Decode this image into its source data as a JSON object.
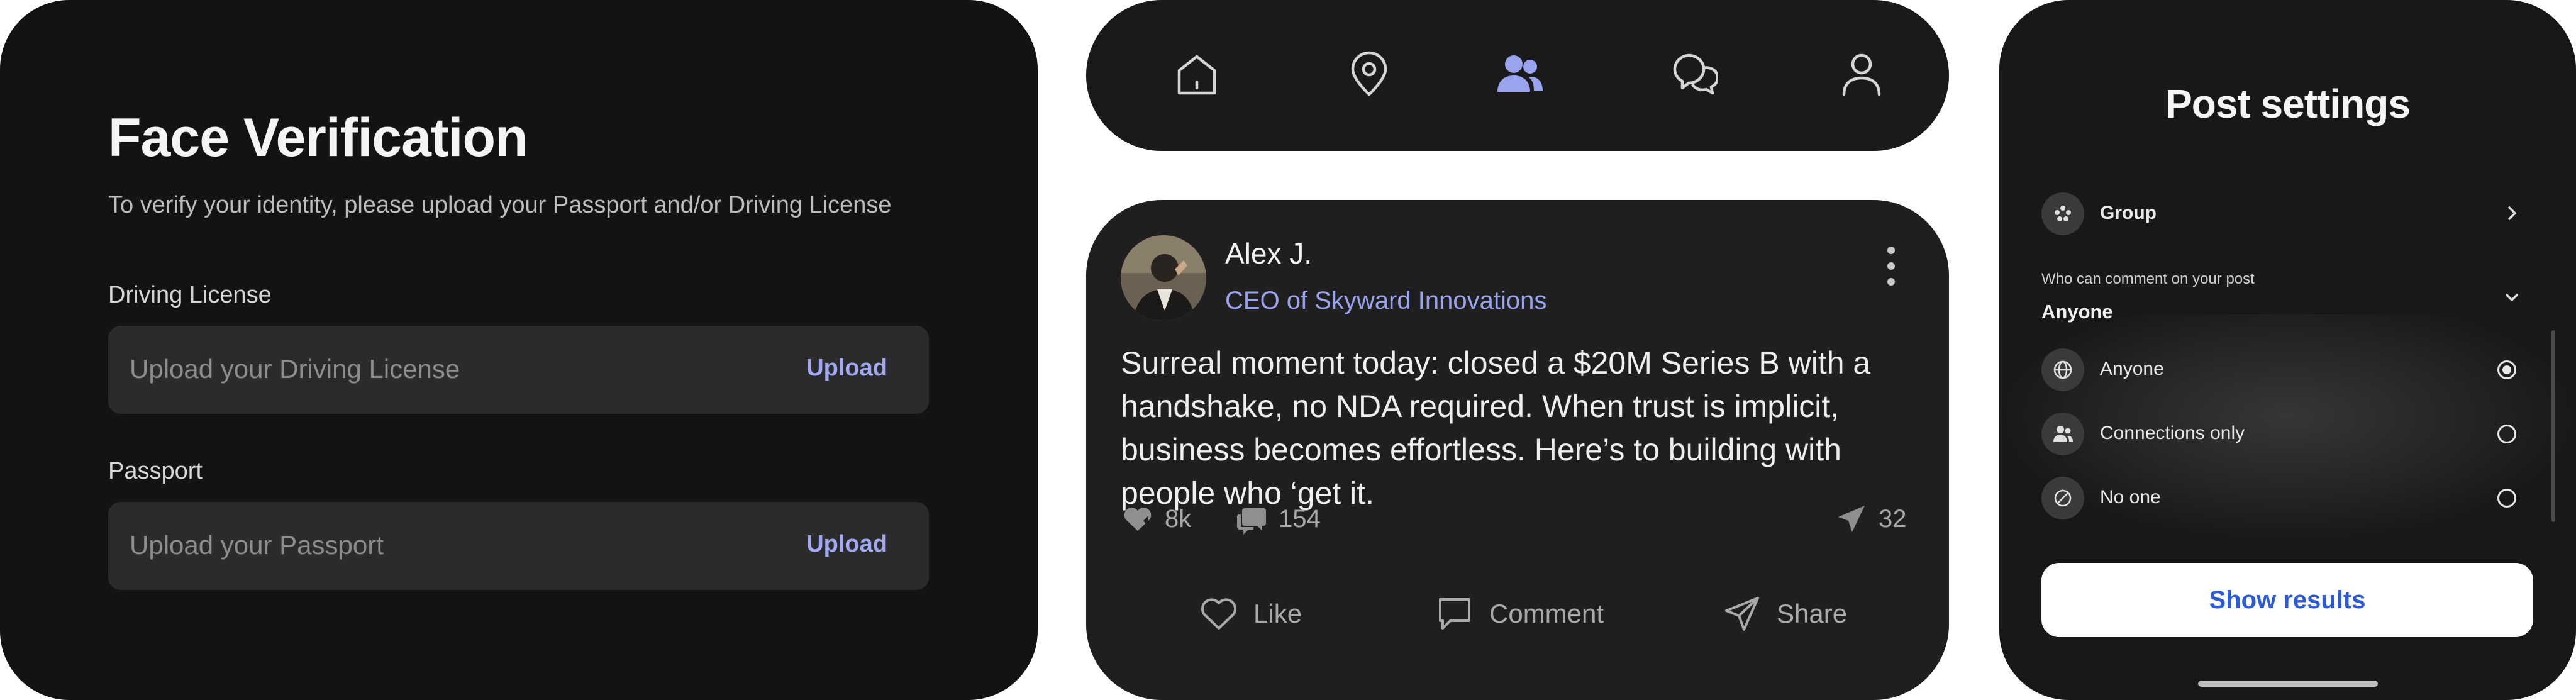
{
  "face_verification": {
    "title": "Face Verification",
    "subtitle": "To verify your identity, please upload your Passport and/or Driving License",
    "driving_license": {
      "label": "Driving License",
      "placeholder": "Upload your Driving License",
      "button": "Upload"
    },
    "passport": {
      "label": "Passport",
      "placeholder": "Upload your Passport",
      "button": "Upload"
    },
    "accent_color": "#a2a9f0"
  },
  "nav_bar": {
    "items": [
      {
        "icon": "home-icon",
        "active": false
      },
      {
        "icon": "location-pin-icon",
        "active": false
      },
      {
        "icon": "people-icon",
        "active": true
      },
      {
        "icon": "chat-bubbles-icon",
        "active": false
      },
      {
        "icon": "profile-icon",
        "active": false
      }
    ],
    "active_color": "#9aa3ee"
  },
  "post": {
    "author": "Alex J.",
    "role": "CEO of Skyward Innovations",
    "body": "Surreal moment today: closed a $20M Series B with a handshake, no NDA required. When trust is implicit, business becomes effortless. Here’s to building with people who ‘get it.",
    "stats": {
      "likes": "8k",
      "comments": "154",
      "shares": "32"
    },
    "actions": {
      "like": "Like",
      "comment": "Comment",
      "share": "Share"
    }
  },
  "post_settings": {
    "title": "Post settings",
    "audience": {
      "icon": "group-icon",
      "label": "Group"
    },
    "comment_question": "Who can comment on your post",
    "comment_selected": "Anyone",
    "options": [
      {
        "icon": "globe-icon",
        "label": "Anyone",
        "selected": true
      },
      {
        "icon": "connections-icon",
        "label": "Connections only",
        "selected": false
      },
      {
        "icon": "blocked-icon",
        "label": "No one",
        "selected": false
      }
    ],
    "button": "Show results",
    "button_color": "#2d5ad6"
  }
}
